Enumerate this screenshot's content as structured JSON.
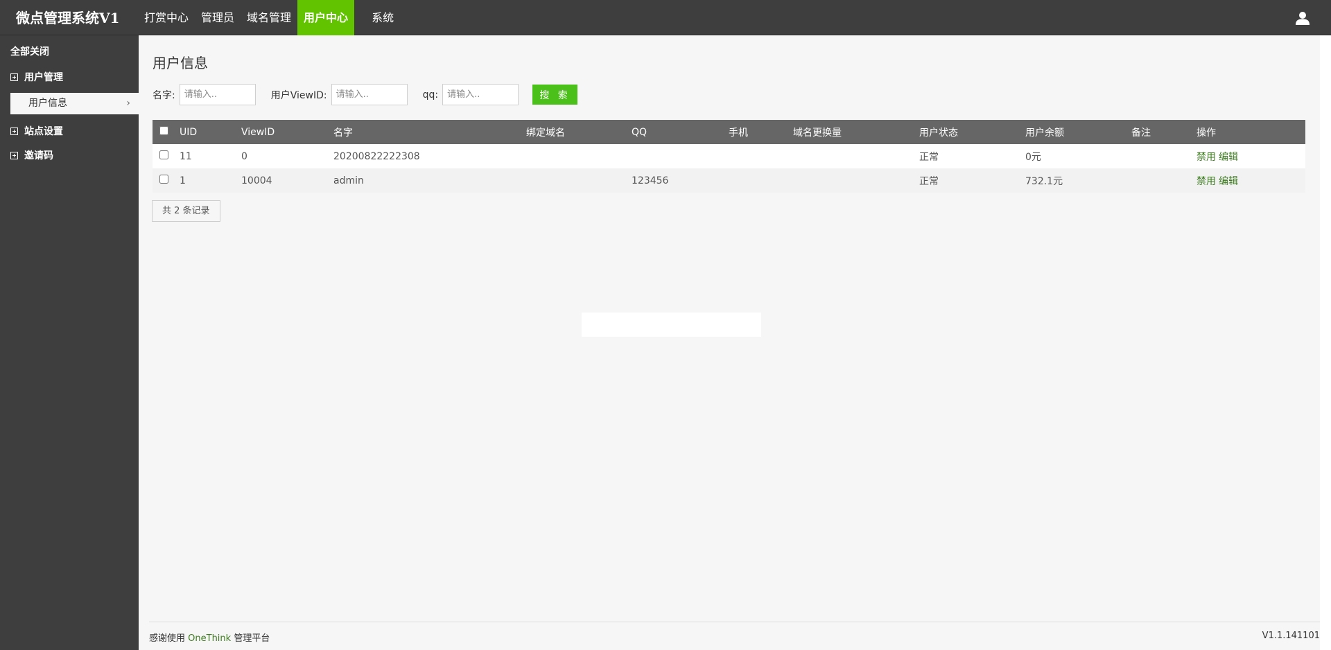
{
  "header": {
    "brand": "微点管理系统V1",
    "nav": [
      {
        "label": "打赏中心",
        "active": false
      },
      {
        "label": "管理员",
        "active": false
      },
      {
        "label": "域名管理",
        "active": false
      },
      {
        "label": "用户中心",
        "active": true
      },
      {
        "label": "系统",
        "active": false
      }
    ],
    "user_icon": "user-icon"
  },
  "sidebar": {
    "collapse_all": "全部关闭",
    "groups": [
      {
        "label": "用户管理",
        "icon": "plus-square-icon",
        "expanded": true,
        "children": [
          {
            "label": "用户信息",
            "active": true
          }
        ]
      },
      {
        "label": "站点设置",
        "icon": "plus-square-icon"
      },
      {
        "label": "邀请码",
        "icon": "plus-square-icon"
      }
    ]
  },
  "main": {
    "title": "用户信息",
    "search": {
      "name_label": "名字:",
      "name_placeholder": "请输入..",
      "viewid_label": "用户ViewID:",
      "viewid_placeholder": "请输入..",
      "qq_label": "qq:",
      "qq_placeholder": "请输入..",
      "button": "搜 索"
    },
    "table": {
      "columns": [
        "UID",
        "ViewID",
        "名字",
        "绑定域名",
        "QQ",
        "手机",
        "域名更换量",
        "用户状态",
        "用户余额",
        "备注",
        "操作"
      ],
      "rows": [
        {
          "uid": "11",
          "viewid": "0",
          "name": "20200822222308",
          "domain": "",
          "qq": "",
          "phone": "",
          "domain_changes": "",
          "status": "正常",
          "balance": "0元",
          "note": "",
          "actions": [
            "禁用",
            "编辑"
          ]
        },
        {
          "uid": "1",
          "viewid": "10004",
          "name": "admin",
          "domain": "",
          "qq": "123456",
          "phone": "",
          "domain_changes": "",
          "status": "正常",
          "balance": "732.1元",
          "note": "",
          "actions": [
            "禁用",
            "编辑"
          ]
        }
      ]
    },
    "record_count": "共 2 条记录"
  },
  "footer": {
    "thanks_prefix": "感谢使用",
    "platform": "OneThink",
    "thanks_suffix": "管理平台",
    "version": "V1.1.141101"
  },
  "colors": {
    "header_bg": "#3e3e3e",
    "active_nav": "#62c400",
    "search_button": "#4bbf1a",
    "table_header": "#666666",
    "link": "#3c7b1e"
  }
}
